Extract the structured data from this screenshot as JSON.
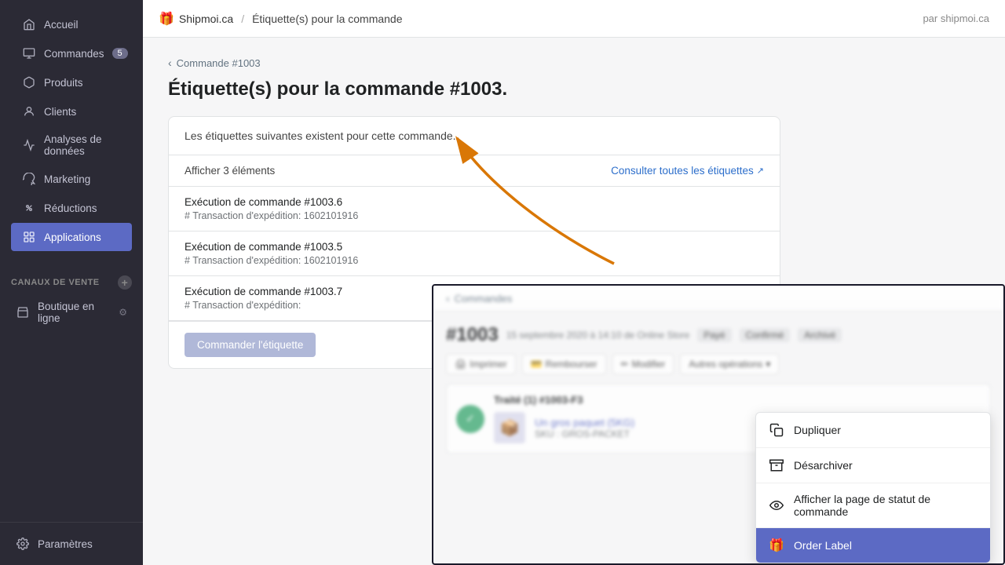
{
  "sidebar": {
    "nav_items": [
      {
        "id": "accueil",
        "label": "Accueil",
        "icon": "home",
        "active": false
      },
      {
        "id": "commandes",
        "label": "Commandes",
        "icon": "orders",
        "badge": "5",
        "active": false
      },
      {
        "id": "produits",
        "label": "Produits",
        "icon": "products",
        "active": false
      },
      {
        "id": "clients",
        "label": "Clients",
        "icon": "clients",
        "active": false
      },
      {
        "id": "analyses",
        "label": "Analyses de données",
        "icon": "analytics",
        "active": false
      },
      {
        "id": "marketing",
        "label": "Marketing",
        "icon": "marketing",
        "active": false
      },
      {
        "id": "reductions",
        "label": "Réductions",
        "icon": "reductions",
        "active": false
      },
      {
        "id": "applications",
        "label": "Applications",
        "icon": "apps",
        "active": true
      }
    ],
    "channels_label": "CANAUX DE VENTE",
    "channels_items": [
      {
        "id": "boutique",
        "label": "Boutique en ligne",
        "icon": "store"
      }
    ],
    "bottom_items": [
      {
        "id": "parametres",
        "label": "Paramètres",
        "icon": "settings"
      }
    ]
  },
  "topbar": {
    "brand_icon": "🎁",
    "brand_name": "Shipmoi.ca",
    "separator": "/",
    "page_title": "Étiquette(s) pour la commande",
    "right_text": "par shipmoi.ca"
  },
  "breadcrumb": {
    "back_label": "Commande #1003"
  },
  "page": {
    "title": "Étiquette(s) pour la commande #1003.",
    "card": {
      "description": "Les étiquettes suivantes existent pour cette commande.",
      "list_header": "Afficher 3 éléments",
      "view_all_link": "Consulter toutes les étiquettes",
      "items": [
        {
          "title": "Exécution de commande #1003.6",
          "subtitle": "# Transaction d'expédition: 1602101916"
        },
        {
          "title": "Exécution de commande #1003.5",
          "subtitle": "# Transaction d'expédition: 1602101916"
        },
        {
          "title": "Exécution de commande #1003.7",
          "subtitle": "# Transaction d'expédition:"
        }
      ],
      "order_button": "Commander l'étiquette"
    }
  },
  "popup": {
    "breadcrumb": "Commandes",
    "order_number": "#1003",
    "order_meta": "15 septembre 2020 à 14:10 de Online Store",
    "badges": [
      "Payé",
      "Confirmé",
      "Archivé"
    ],
    "actions": [
      "Imprimer",
      "Rembourser",
      "Modifier",
      "Autres opérations"
    ],
    "item_title": "Traité (1) #1003-F3",
    "item_name": "Un gros paquet (5KG)",
    "item_sku": "SKU : GROS-PACKET"
  },
  "dropdown": {
    "items": [
      {
        "id": "dupliquer",
        "label": "Dupliquer",
        "icon": "duplicate",
        "active": false
      },
      {
        "id": "desarchiver",
        "label": "Désarchiver",
        "icon": "archive",
        "active": false
      },
      {
        "id": "statut",
        "label": "Afficher la page de statut de commande",
        "icon": "eye",
        "active": false
      },
      {
        "id": "order-label",
        "label": "Order Label",
        "icon": "shipmoi",
        "active": true
      }
    ]
  },
  "arrow": {
    "color": "#d97706"
  }
}
